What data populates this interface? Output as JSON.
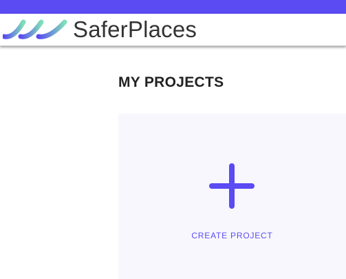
{
  "colors": {
    "accent": "#5a4bf2",
    "card_background": "#f7f7fd",
    "logo_gradient_start": "#5a4bf2",
    "logo_gradient_end": "#7fe0b8"
  },
  "header": {
    "brand_name": "SaferPlaces",
    "logo_icon": "wave-logo-icon"
  },
  "main": {
    "section_title": "MY PROJECTS",
    "create_card": {
      "icon": "plus-icon",
      "label": "CREATE PROJECT"
    }
  }
}
